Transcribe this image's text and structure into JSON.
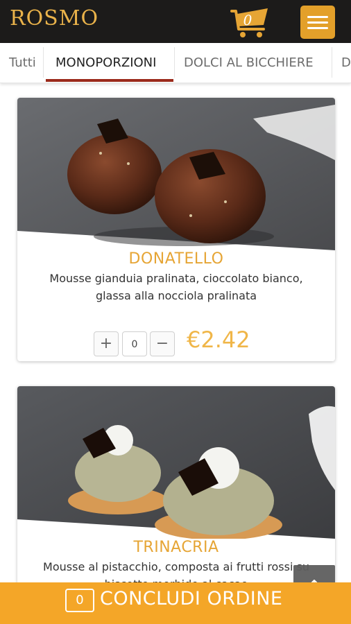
{
  "header": {
    "brand": "ROSMO",
    "cart_count": "0"
  },
  "tabs": [
    {
      "label": "Tutti"
    },
    {
      "label": "MONOPORZIONI"
    },
    {
      "label": "DOLCI AL BICCHIERE"
    },
    {
      "label": "D"
    }
  ],
  "active_tab": "MONOPORZIONI",
  "products": [
    {
      "name": "DONATELLO",
      "description": "Mousse gianduia pralinata, cioccolato bianco, glassa alla nocciola pralinata",
      "quantity": "0",
      "price": "€2.42",
      "plus_symbol": "+",
      "minus_symbol": "−"
    },
    {
      "name": "TRINACRIA",
      "description": "Mousse al pistacchio, composta ai frutti rossi su biscotto morbido al cacao"
    }
  ],
  "order_bar": {
    "count": "0",
    "label": "CONCLUDI ORDINE"
  },
  "colors": {
    "accent": "#e6a535",
    "header_bg": "#1c1b1a",
    "menu_button": "#e3a02a",
    "order_bar": "#f4a628",
    "tab_underline": "#9b2a1b"
  },
  "icons": [
    "cart-icon",
    "hamburger-menu-icon",
    "arrow-up-icon"
  ]
}
